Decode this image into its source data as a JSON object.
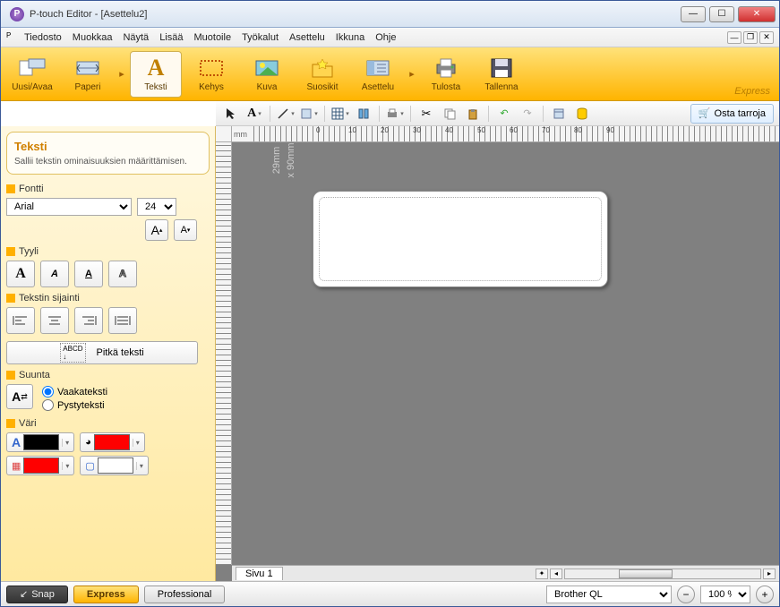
{
  "window": {
    "title": "P-touch Editor - [Asettelu2]",
    "icon_letter": "P"
  },
  "menu": {
    "items": [
      "Tiedosto",
      "Muokkaa",
      "Näytä",
      "Lisää",
      "Muotoile",
      "Työkalut",
      "Asettelu",
      "Ikkuna",
      "Ohje"
    ]
  },
  "ribbon": {
    "new_open": "Uusi/Avaa",
    "paper": "Paperi",
    "text": "Teksti",
    "frame": "Kehys",
    "image": "Kuva",
    "favorites": "Suosikit",
    "layout": "Asettelu",
    "print": "Tulosta",
    "save": "Tallenna",
    "mode_label": "Express"
  },
  "toolbar": {
    "buy_label": "Osta tarroja"
  },
  "panel": {
    "title": "Teksti",
    "desc": "Sallii tekstin ominaisuuksien määrittämisen.",
    "font_label": "Fontti",
    "font_value": "Arial",
    "font_size": "24",
    "style_label": "Tyyli",
    "position_label": "Tekstin sijainti",
    "long_text_label": "Pitkä teksti",
    "direction_label": "Suunta",
    "dir_horizontal": "Vaakateksti",
    "dir_vertical": "Pystyteksti",
    "color_label": "Väri",
    "colors": {
      "text": "#000000",
      "fill": "#ff0000",
      "bg1": "#ff0000",
      "bg2": "#ffffff"
    }
  },
  "canvas": {
    "ruler_unit": "mm",
    "ruler_marks": [
      "0",
      "10",
      "20",
      "30",
      "40",
      "50",
      "60",
      "70",
      "80",
      "90"
    ],
    "label_dim1": "29mm",
    "label_dim2": "x 90mm",
    "page_tab": "Sivu 1"
  },
  "status": {
    "mode_snap": "Snap",
    "mode_express": "Express",
    "mode_pro": "Professional",
    "printer": "Brother QL",
    "zoom": "100 %"
  }
}
